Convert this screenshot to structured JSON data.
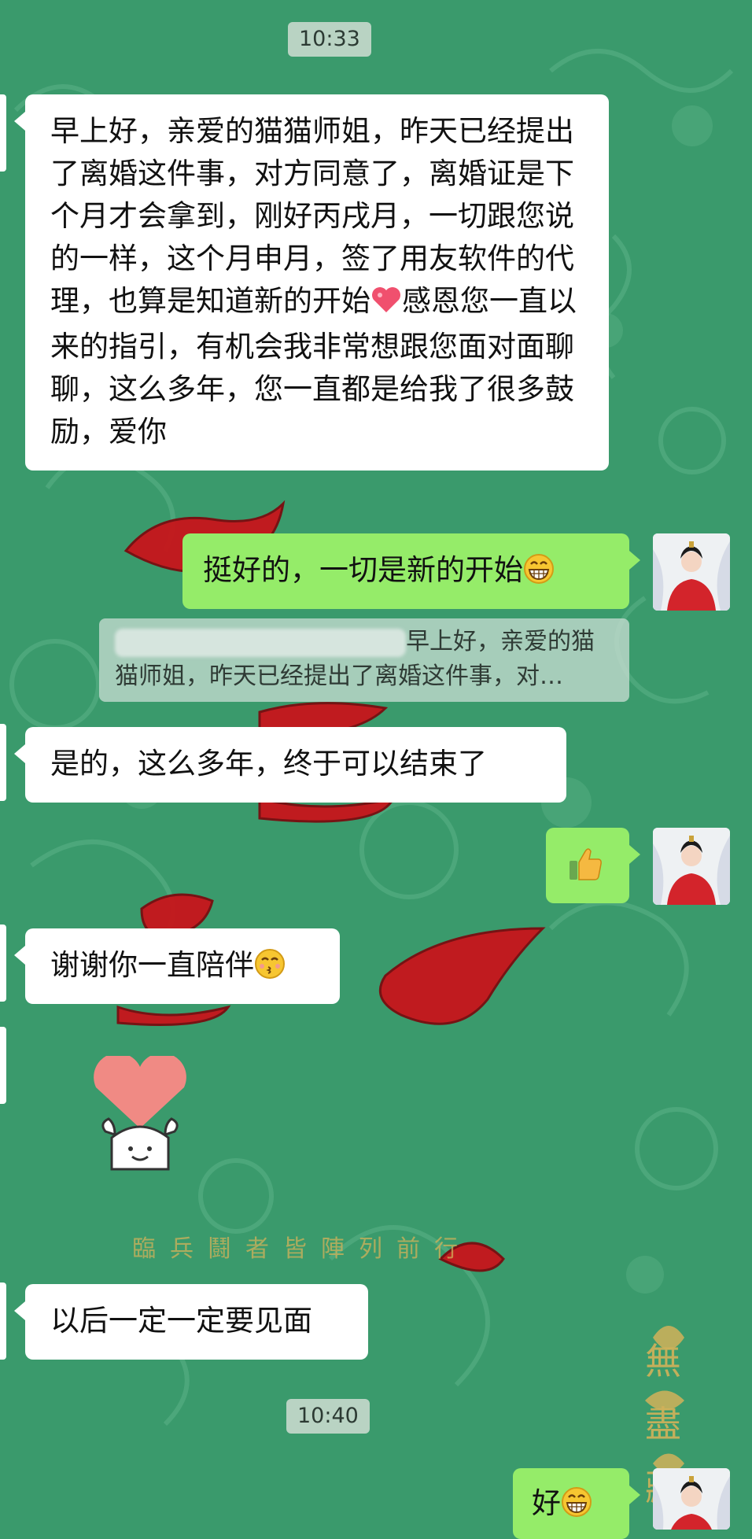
{
  "timestamps": [
    "10:33",
    "10:40"
  ],
  "messages": {
    "m1": "早上好，亲爱的猫猫师姐，昨天已经提出了离婚这件事，对方同意了，离婚证是下个月才会拿到，刚好丙戌月，一切跟您说的一样，这个月申月，签了用友软件的代理，也算是知道新的开始",
    "m1_tail": "感恩您一直以来的指引，有机会我非常想跟您面对面聊聊，这么多年，您一直都是给我了很多鼓励，爱你",
    "m2": "挺好的，一切是新的开始",
    "m2_quote": "早上好，亲爱的猫猫师姐，昨天已经提出了离婚这件事，对…",
    "m3": "是的，这么多年，终于可以结束了",
    "m5": "谢谢你一直陪伴",
    "m7": "以后一定一定要见面",
    "m8": "好"
  },
  "background": {
    "mantra": "臨兵鬪者皆陣列前行",
    "corner_text": "無盡藏"
  },
  "colors": {
    "background": "#3a9a6c",
    "incoming_bubble": "#ffffff",
    "outgoing_bubble": "#95ec69",
    "timestamp_bg": "#b9d3c3"
  },
  "icons": [
    "heart-emoji",
    "grin-emoji",
    "thumbs-up-emoji",
    "kiss-emoji",
    "heart-sticker",
    "avatar-photo"
  ]
}
